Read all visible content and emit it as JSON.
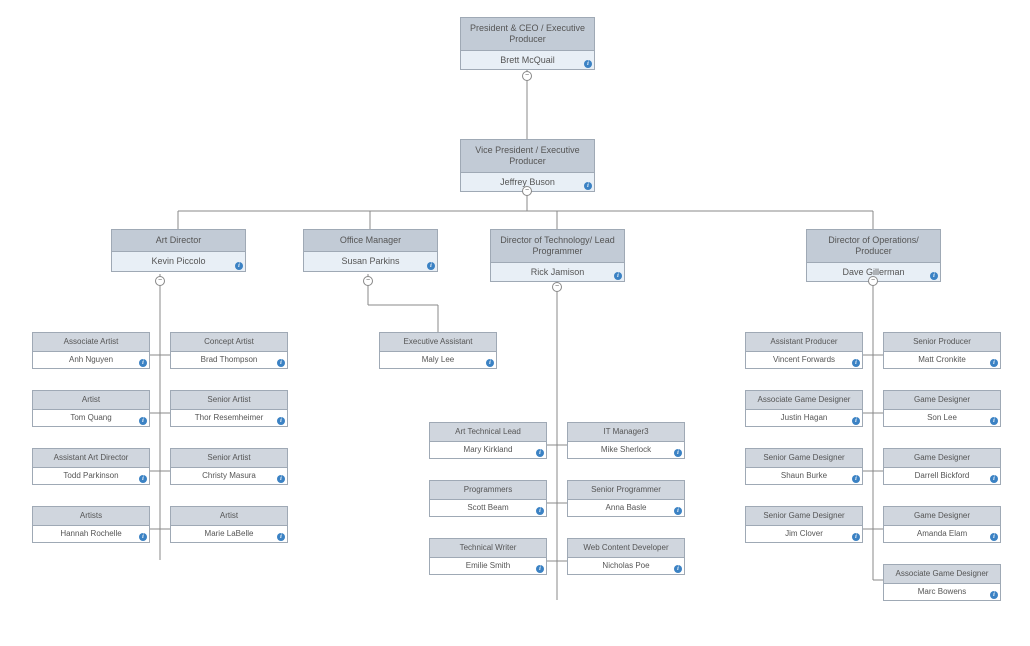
{
  "chart_data": {
    "type": "org-chart",
    "root": {
      "title": "President & CEO / Executive Producer",
      "name": "Brett McQuail",
      "children": [
        {
          "title": "Vice President / Executive Producer",
          "name": "Jeffrey Buson",
          "children": [
            {
              "title": "Art Director",
              "name": "Kevin Piccolo",
              "children": [
                {
                  "title": "Associate Artist",
                  "name": "Anh Nguyen"
                },
                {
                  "title": "Concept Artist",
                  "name": "Brad Thompson"
                },
                {
                  "title": "Artist",
                  "name": "Tom Quang"
                },
                {
                  "title": "Senior Artist",
                  "name": "Thor Resemheimer"
                },
                {
                  "title": "Assistant Art Director",
                  "name": "Todd Parkinson"
                },
                {
                  "title": "Senior Artist",
                  "name": "Christy Masura"
                },
                {
                  "title": "Artists",
                  "name": "Hannah Rochelle"
                },
                {
                  "title": "Artist",
                  "name": "Marie LaBelle"
                }
              ]
            },
            {
              "title": "Office Manager",
              "name": "Susan Parkins",
              "children": [
                {
                  "title": "Executive Assistant",
                  "name": "Maly Lee"
                }
              ]
            },
            {
              "title": "Director of Technology/ Lead Programmer",
              "name": "Rick Jamison",
              "children": [
                {
                  "title": "Art Technical Lead",
                  "name": "Mary Kirkland"
                },
                {
                  "title": "IT Manager3",
                  "name": "Mike Sherlock"
                },
                {
                  "title": "Programmers",
                  "name": "Scott Beam"
                },
                {
                  "title": "Senior Programmer",
                  "name": "Anna Basle"
                },
                {
                  "title": "Technical Writer",
                  "name": "Emilie Smith"
                },
                {
                  "title": "Web Content Developer",
                  "name": "Nicholas Poe"
                }
              ]
            },
            {
              "title": "Director of Operations/ Producer",
              "name": "Dave Gillerman",
              "children": [
                {
                  "title": "Assistant Producer",
                  "name": "Vincent Forwards"
                },
                {
                  "title": "Senior Producer",
                  "name": "Matt Cronkite"
                },
                {
                  "title": "Associate Game Designer",
                  "name": "Justin Hagan"
                },
                {
                  "title": "Game Designer",
                  "name": "Son Lee"
                },
                {
                  "title": "Senior Game Designer",
                  "name": "Shaun Burke"
                },
                {
                  "title": "Game Designer",
                  "name": "Darrell Bickford"
                },
                {
                  "title": "Senior Game Designer",
                  "name": "Jim Clover"
                },
                {
                  "title": "Game Designer",
                  "name": "Amanda Elam"
                },
                {
                  "title": "Associate Game Designer",
                  "name": "Marc Bowens"
                }
              ]
            }
          ]
        }
      ]
    }
  },
  "nodes": {
    "n0": {
      "title": "President & CEO / Executive Producer",
      "name": "Brett McQuail"
    },
    "n1": {
      "title": "Vice President / Executive Producer",
      "name": "Jeffrey Buson"
    },
    "n2": {
      "title": "Art Director",
      "name": "Kevin Piccolo"
    },
    "n3": {
      "title": "Office Manager",
      "name": "Susan Parkins"
    },
    "n4": {
      "title": "Director of Technology/ Lead Programmer",
      "name": "Rick Jamison"
    },
    "n5": {
      "title": "Director of Operations/ Producer",
      "name": "Dave Gillerman"
    },
    "a0": {
      "title": "Associate Artist",
      "name": "Anh Nguyen"
    },
    "a1": {
      "title": "Concept Artist",
      "name": "Brad Thompson"
    },
    "a2": {
      "title": "Artist",
      "name": "Tom Quang"
    },
    "a3": {
      "title": "Senior Artist",
      "name": "Thor Resemheimer"
    },
    "a4": {
      "title": "Assistant Art Director",
      "name": "Todd Parkinson"
    },
    "a5": {
      "title": "Senior Artist",
      "name": "Christy Masura"
    },
    "a6": {
      "title": "Artists",
      "name": "Hannah Rochelle"
    },
    "a7": {
      "title": "Artist",
      "name": "Marie LaBelle"
    },
    "o0": {
      "title": "Executive Assistant",
      "name": "Maly Lee"
    },
    "t0": {
      "title": "Art Technical Lead",
      "name": "Mary Kirkland"
    },
    "t1": {
      "title": "IT Manager3",
      "name": "Mike Sherlock"
    },
    "t2": {
      "title": "Programmers",
      "name": "Scott Beam"
    },
    "t3": {
      "title": "Senior Programmer",
      "name": "Anna Basle"
    },
    "t4": {
      "title": "Technical Writer",
      "name": "Emilie Smith"
    },
    "t5": {
      "title": "Web Content Developer",
      "name": "Nicholas Poe"
    },
    "p0": {
      "title": "Assistant Producer",
      "name": "Vincent Forwards"
    },
    "p1": {
      "title": "Senior Producer",
      "name": "Matt Cronkite"
    },
    "p2": {
      "title": "Associate Game Designer",
      "name": "Justin Hagan"
    },
    "p3": {
      "title": "Game Designer",
      "name": "Son Lee"
    },
    "p4": {
      "title": "Senior Game Designer",
      "name": "Shaun Burke"
    },
    "p5": {
      "title": "Game Designer",
      "name": "Darrell Bickford"
    },
    "p6": {
      "title": "Senior Game Designer",
      "name": "Jim Clover"
    },
    "p7": {
      "title": "Game Designer",
      "name": "Amanda Elam"
    },
    "p8": {
      "title": "Associate Game Designer",
      "name": "Marc Bowens"
    }
  },
  "icons": {
    "info": "i",
    "collapse": "−"
  }
}
